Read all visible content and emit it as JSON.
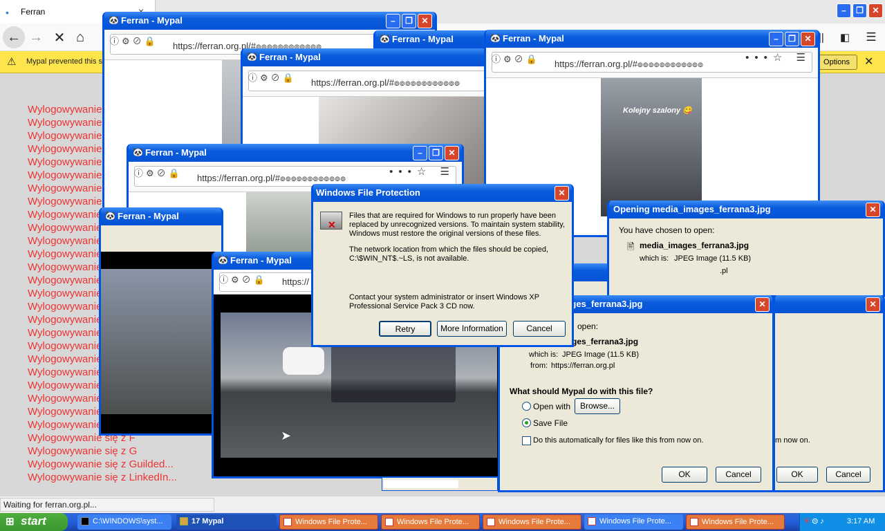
{
  "main_browser": {
    "tab_title": "Ferran",
    "notification": "Mypal prevented this s",
    "options_label": "Options",
    "status": "Waiting for ferran.org.pl...",
    "log_lines": [
      "Wylogowywanie",
      "Wylogowywanie",
      "Wylogowywanie",
      "Wylogowywanie",
      "Wylogowywanie",
      "Wylogowywanie",
      "Wylogowywanie",
      "Wylogowywanie",
      "Wylogowywanie",
      "Wylogowywanie",
      "Wylogowywanie",
      "Wylogowywanie",
      "Wylogowywanie",
      "Wylogowywanie",
      "Wylogowywanie",
      "Wylogowywanie",
      "Wylogowywanie",
      "Wylogowywanie",
      "Wylogowywanie",
      "Wylogowywanie",
      "Wylogowywanie",
      "Wylogowywanie",
      "Wylogowywanie",
      "Wylogowywanie",
      "Wylogowywanie się z G",
      "Wylogowywanie się z F",
      "Wylogowywanie się z G",
      "Wylogowywanie się z Guilded...",
      "Wylogowywanie się z LinkedIn..."
    ]
  },
  "popup": {
    "title": "Ferran - Mypal",
    "url": "https://ferran.org.pl/#๏๏๏๏๏๏๏๏๏๏๏๏",
    "url_short": "https://",
    "video_caption": "Kolejny szalony 😋"
  },
  "wfp": {
    "title": "Windows File Protection",
    "text1": "Files that are required for Windows to run properly have been replaced by unrecognized versions.  To maintain system stability, Windows must restore the original versions of these files.",
    "text2": "The network location from which the files should be copied, C:\\$WIN_NT$.~LS, is not available.",
    "text3": "Contact your system administrator or insert Windows XP Professional Service Pack 3 CD now.",
    "retry": "Retry",
    "more": "More Information",
    "cancel": "Cancel"
  },
  "download": {
    "title": "Opening media_images_ferrana3.jpg",
    "title_short": "images_ferrana3.jpg",
    "chosen": "You have chosen to open:",
    "filename": "media_images_ferrana3.jpg",
    "filename_short": "ges_ferrana3.jpg",
    "which_label": "which is:",
    "which_value": "JPEG Image (11.5 KB)",
    "from_label": "from:",
    "from_value": "https://ferran.org.pl",
    "from_short": ".pl",
    "open_text": "open:",
    "question": "What should Mypal do with this file?",
    "open_with": "Open with",
    "browse": "Browse...",
    "save_file": "Save File",
    "auto": "Do this automatically for files like this from now on.",
    "auto_short": "m now on.",
    "ok": "OK",
    "cancel": "Cancel"
  },
  "taskbar": {
    "start": "start",
    "cmd": "C:\\WINDOWS\\syst...",
    "mypal": "17 Mypal",
    "wfp_task": "Windows File Prote...",
    "clock": "3:17 AM"
  }
}
